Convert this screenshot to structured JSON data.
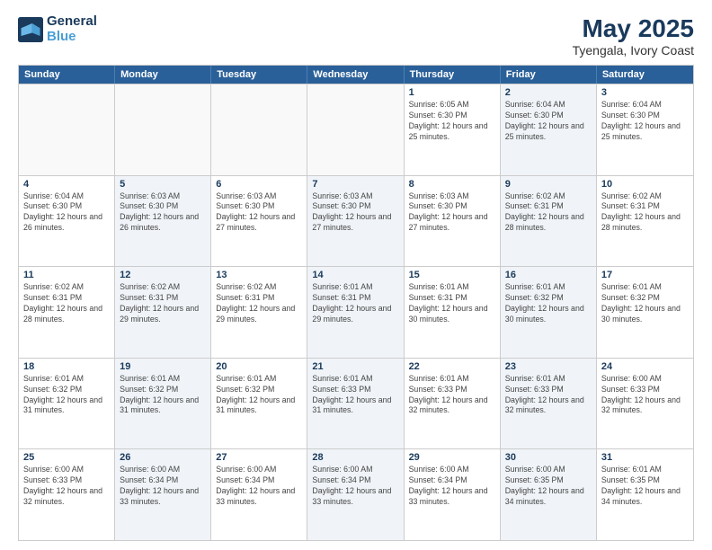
{
  "header": {
    "logo_line1": "General",
    "logo_line2": "Blue",
    "title": "May 2025",
    "location": "Tyengala, Ivory Coast"
  },
  "days_of_week": [
    "Sunday",
    "Monday",
    "Tuesday",
    "Wednesday",
    "Thursday",
    "Friday",
    "Saturday"
  ],
  "weeks": [
    [
      {
        "day": "",
        "info": "",
        "shaded": false,
        "empty": true
      },
      {
        "day": "",
        "info": "",
        "shaded": false,
        "empty": true
      },
      {
        "day": "",
        "info": "",
        "shaded": false,
        "empty": true
      },
      {
        "day": "",
        "info": "",
        "shaded": false,
        "empty": true
      },
      {
        "day": "1",
        "info": "Sunrise: 6:05 AM\nSunset: 6:30 PM\nDaylight: 12 hours\nand 25 minutes.",
        "shaded": false,
        "empty": false
      },
      {
        "day": "2",
        "info": "Sunrise: 6:04 AM\nSunset: 6:30 PM\nDaylight: 12 hours\nand 25 minutes.",
        "shaded": true,
        "empty": false
      },
      {
        "day": "3",
        "info": "Sunrise: 6:04 AM\nSunset: 6:30 PM\nDaylight: 12 hours\nand 25 minutes.",
        "shaded": false,
        "empty": false
      }
    ],
    [
      {
        "day": "4",
        "info": "Sunrise: 6:04 AM\nSunset: 6:30 PM\nDaylight: 12 hours\nand 26 minutes.",
        "shaded": false,
        "empty": false
      },
      {
        "day": "5",
        "info": "Sunrise: 6:03 AM\nSunset: 6:30 PM\nDaylight: 12 hours\nand 26 minutes.",
        "shaded": true,
        "empty": false
      },
      {
        "day": "6",
        "info": "Sunrise: 6:03 AM\nSunset: 6:30 PM\nDaylight: 12 hours\nand 27 minutes.",
        "shaded": false,
        "empty": false
      },
      {
        "day": "7",
        "info": "Sunrise: 6:03 AM\nSunset: 6:30 PM\nDaylight: 12 hours\nand 27 minutes.",
        "shaded": true,
        "empty": false
      },
      {
        "day": "8",
        "info": "Sunrise: 6:03 AM\nSunset: 6:30 PM\nDaylight: 12 hours\nand 27 minutes.",
        "shaded": false,
        "empty": false
      },
      {
        "day": "9",
        "info": "Sunrise: 6:02 AM\nSunset: 6:31 PM\nDaylight: 12 hours\nand 28 minutes.",
        "shaded": true,
        "empty": false
      },
      {
        "day": "10",
        "info": "Sunrise: 6:02 AM\nSunset: 6:31 PM\nDaylight: 12 hours\nand 28 minutes.",
        "shaded": false,
        "empty": false
      }
    ],
    [
      {
        "day": "11",
        "info": "Sunrise: 6:02 AM\nSunset: 6:31 PM\nDaylight: 12 hours\nand 28 minutes.",
        "shaded": false,
        "empty": false
      },
      {
        "day": "12",
        "info": "Sunrise: 6:02 AM\nSunset: 6:31 PM\nDaylight: 12 hours\nand 29 minutes.",
        "shaded": true,
        "empty": false
      },
      {
        "day": "13",
        "info": "Sunrise: 6:02 AM\nSunset: 6:31 PM\nDaylight: 12 hours\nand 29 minutes.",
        "shaded": false,
        "empty": false
      },
      {
        "day": "14",
        "info": "Sunrise: 6:01 AM\nSunset: 6:31 PM\nDaylight: 12 hours\nand 29 minutes.",
        "shaded": true,
        "empty": false
      },
      {
        "day": "15",
        "info": "Sunrise: 6:01 AM\nSunset: 6:31 PM\nDaylight: 12 hours\nand 30 minutes.",
        "shaded": false,
        "empty": false
      },
      {
        "day": "16",
        "info": "Sunrise: 6:01 AM\nSunset: 6:32 PM\nDaylight: 12 hours\nand 30 minutes.",
        "shaded": true,
        "empty": false
      },
      {
        "day": "17",
        "info": "Sunrise: 6:01 AM\nSunset: 6:32 PM\nDaylight: 12 hours\nand 30 minutes.",
        "shaded": false,
        "empty": false
      }
    ],
    [
      {
        "day": "18",
        "info": "Sunrise: 6:01 AM\nSunset: 6:32 PM\nDaylight: 12 hours\nand 31 minutes.",
        "shaded": false,
        "empty": false
      },
      {
        "day": "19",
        "info": "Sunrise: 6:01 AM\nSunset: 6:32 PM\nDaylight: 12 hours\nand 31 minutes.",
        "shaded": true,
        "empty": false
      },
      {
        "day": "20",
        "info": "Sunrise: 6:01 AM\nSunset: 6:32 PM\nDaylight: 12 hours\nand 31 minutes.",
        "shaded": false,
        "empty": false
      },
      {
        "day": "21",
        "info": "Sunrise: 6:01 AM\nSunset: 6:33 PM\nDaylight: 12 hours\nand 31 minutes.",
        "shaded": true,
        "empty": false
      },
      {
        "day": "22",
        "info": "Sunrise: 6:01 AM\nSunset: 6:33 PM\nDaylight: 12 hours\nand 32 minutes.",
        "shaded": false,
        "empty": false
      },
      {
        "day": "23",
        "info": "Sunrise: 6:01 AM\nSunset: 6:33 PM\nDaylight: 12 hours\nand 32 minutes.",
        "shaded": true,
        "empty": false
      },
      {
        "day": "24",
        "info": "Sunrise: 6:00 AM\nSunset: 6:33 PM\nDaylight: 12 hours\nand 32 minutes.",
        "shaded": false,
        "empty": false
      }
    ],
    [
      {
        "day": "25",
        "info": "Sunrise: 6:00 AM\nSunset: 6:33 PM\nDaylight: 12 hours\nand 32 minutes.",
        "shaded": false,
        "empty": false
      },
      {
        "day": "26",
        "info": "Sunrise: 6:00 AM\nSunset: 6:34 PM\nDaylight: 12 hours\nand 33 minutes.",
        "shaded": true,
        "empty": false
      },
      {
        "day": "27",
        "info": "Sunrise: 6:00 AM\nSunset: 6:34 PM\nDaylight: 12 hours\nand 33 minutes.",
        "shaded": false,
        "empty": false
      },
      {
        "day": "28",
        "info": "Sunrise: 6:00 AM\nSunset: 6:34 PM\nDaylight: 12 hours\nand 33 minutes.",
        "shaded": true,
        "empty": false
      },
      {
        "day": "29",
        "info": "Sunrise: 6:00 AM\nSunset: 6:34 PM\nDaylight: 12 hours\nand 33 minutes.",
        "shaded": false,
        "empty": false
      },
      {
        "day": "30",
        "info": "Sunrise: 6:00 AM\nSunset: 6:35 PM\nDaylight: 12 hours\nand 34 minutes.",
        "shaded": true,
        "empty": false
      },
      {
        "day": "31",
        "info": "Sunrise: 6:01 AM\nSunset: 6:35 PM\nDaylight: 12 hours\nand 34 minutes.",
        "shaded": false,
        "empty": false
      }
    ]
  ]
}
